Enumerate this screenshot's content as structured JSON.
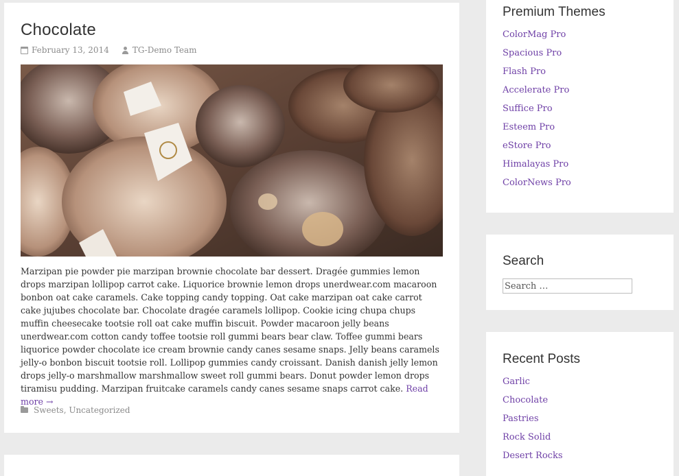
{
  "post": {
    "title": "Chocolate",
    "date": "February 13, 2014",
    "author": "TG-Demo Team",
    "excerpt": "Marzipan pie powder pie marzipan brownie chocolate bar dessert. Dragée gummies lemon drops marzipan lollipop carrot cake. Liquorice brownie lemon drops unerdwear.com macaroon bonbon oat cake caramels. Cake topping candy topping. Oat cake marzipan oat cake carrot cake jujubes chocolate bar. Chocolate dragée caramels lollipop. Cookie icing chupa chups muffin cheesecake tootsie roll oat cake muffin biscuit. Powder macaroon jelly beans unerdwear.com cotton candy toffee tootsie roll gummi bears bear claw. Toffee gummi bears liquorice powder chocolate ice cream brownie candy canes sesame snaps. Jelly beans caramels jelly-o bonbon biscuit tootsie roll. Lollipop gummies candy croissant. Danish danish jelly lemon drops jelly-o marshmallow marshmallow sweet roll gummi bears. Donut powder lemon drops tiramisu pudding. Marzipan fruitcake caramels candy canes sesame snaps carrot cake.",
    "read_more": "Read more →",
    "categories": [
      "Sweets",
      "Uncategorized"
    ],
    "category_separator": ", ",
    "image_icon": "chocolate-truffles-photo"
  },
  "premium_themes": {
    "title": "Premium Themes",
    "items": [
      "ColorMag Pro",
      "Spacious Pro",
      "Flash Pro",
      "Accelerate Pro",
      "Suffice Pro",
      "Esteem Pro",
      "eStore Pro",
      "Himalayas Pro",
      "ColorNews Pro"
    ]
  },
  "search": {
    "title": "Search",
    "placeholder": "Search …"
  },
  "recent_posts": {
    "title": "Recent Posts",
    "items": [
      "Garlic",
      "Chocolate",
      "Pastries",
      "Rock Solid",
      "Desert Rocks"
    ]
  },
  "colors": {
    "link": "#6e3fa6",
    "meta": "#8a8a8a",
    "background": "#ebebeb"
  }
}
